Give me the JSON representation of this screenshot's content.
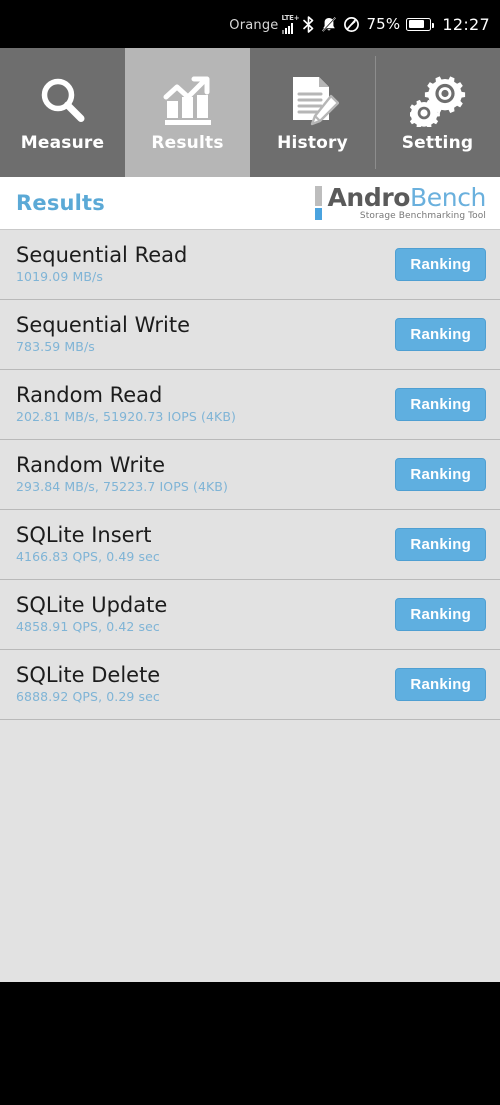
{
  "status_bar": {
    "carrier": "Orange",
    "network_type": "LTE+",
    "signal_icon": "signal-bars-icon",
    "bluetooth_icon": "bluetooth-icon",
    "mute_icon": "bell-muted-icon",
    "dnd_icon": "do-not-disturb-icon",
    "battery_percent": "75%",
    "battery_icon": "battery-icon",
    "time": "12:27"
  },
  "tabs": [
    {
      "label": "Measure",
      "icon": "magnifier-icon",
      "active": false
    },
    {
      "label": "Results",
      "icon": "bar-chart-trend-icon",
      "active": true
    },
    {
      "label": "History",
      "icon": "document-pencil-icon",
      "active": false
    },
    {
      "label": "Setting",
      "icon": "gears-icon",
      "active": false
    }
  ],
  "header": {
    "page_title": "Results",
    "logo_andro": "Andro",
    "logo_bench": "Bench",
    "logo_tagline": "Storage Benchmarking Tool"
  },
  "results": {
    "button_label": "Ranking",
    "rows": [
      {
        "title": "Sequential Read",
        "value": "1019.09 MB/s"
      },
      {
        "title": "Sequential Write",
        "value": "783.59 MB/s"
      },
      {
        "title": "Random Read",
        "value": "202.81 MB/s, 51920.73 IOPS (4KB)"
      },
      {
        "title": "Random Write",
        "value": "293.84 MB/s, 75223.7 IOPS (4KB)"
      },
      {
        "title": "SQLite Insert",
        "value": "4166.83 QPS, 0.49 sec"
      },
      {
        "title": "SQLite Update",
        "value": "4858.91 QPS, 0.42 sec"
      },
      {
        "title": "SQLite Delete",
        "value": "6888.92 QPS, 0.29 sec"
      }
    ]
  },
  "colors": {
    "accent_blue": "#5fafe0",
    "title_blue": "#5ba9d6",
    "value_blue": "#7fb4d6",
    "tab_inactive": "#6e6e6e",
    "tab_active": "#b6b6b6",
    "list_bg": "#e2e2e2"
  }
}
